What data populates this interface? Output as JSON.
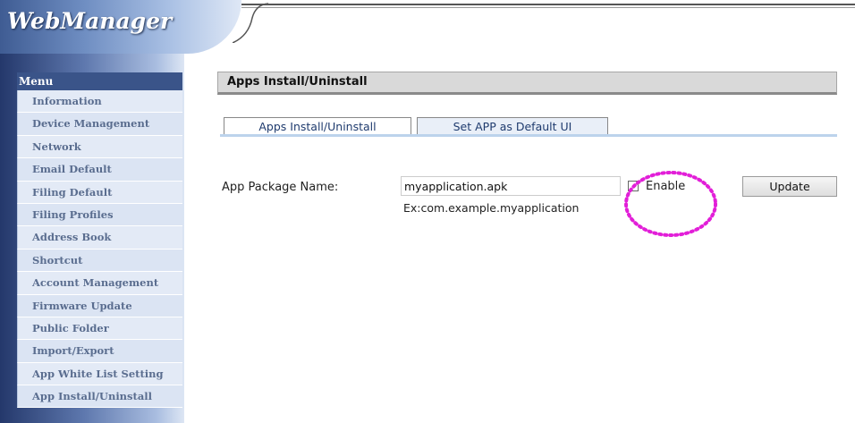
{
  "header": {
    "logo_text": "WebManager"
  },
  "sidebar": {
    "menu_title": "Menu",
    "items": [
      {
        "label": "Information"
      },
      {
        "label": "Device Management"
      },
      {
        "label": "Network"
      },
      {
        "label": "Email Default"
      },
      {
        "label": "Filing Default"
      },
      {
        "label": "Filing Profiles"
      },
      {
        "label": "Address Book"
      },
      {
        "label": "Shortcut"
      },
      {
        "label": "Account Management"
      },
      {
        "label": "Firmware Update"
      },
      {
        "label": "Public Folder"
      },
      {
        "label": "Import/Export"
      },
      {
        "label": "App White List Setting"
      },
      {
        "label": "App Install/Uninstall"
      }
    ]
  },
  "main": {
    "page_title": "Apps Install/Uninstall",
    "tabs": [
      {
        "label": "Apps Install/Uninstall"
      },
      {
        "label": "Set APP as Default UI"
      }
    ],
    "form": {
      "package_label": "App Package Name:",
      "package_value": "myapplication.apk",
      "enable_label": "Enable",
      "example_text": "Ex:com.example.myapplication",
      "update_label": "Update"
    }
  },
  "colors": {
    "highlight": "#e21fd8",
    "menu_header": "#3a5489",
    "tab_text": "#1f3b6e"
  }
}
